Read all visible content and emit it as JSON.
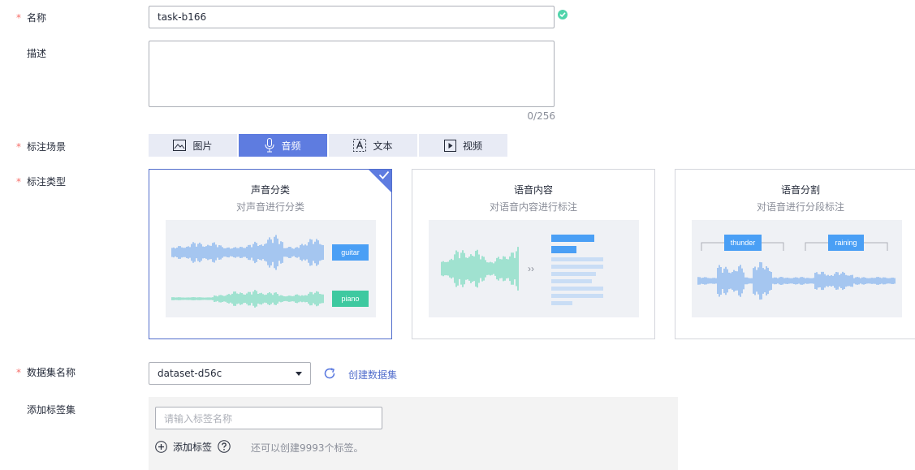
{
  "form": {
    "name": {
      "label": "名称",
      "value": "task-b166"
    },
    "description": {
      "label": "描述",
      "counter": "0/256"
    },
    "scene": {
      "label": "标注场景",
      "tabs": [
        {
          "label": "图片",
          "icon": "image-icon"
        },
        {
          "label": "音频",
          "icon": "microphone-icon",
          "active": true
        },
        {
          "label": "文本",
          "icon": "text-icon"
        },
        {
          "label": "视频",
          "icon": "video-icon"
        }
      ]
    },
    "type": {
      "label": "标注类型",
      "cards": [
        {
          "title": "声音分类",
          "subtitle": "对声音进行分类",
          "tags": [
            "guitar",
            "piano"
          ],
          "selected": true
        },
        {
          "title": "语音内容",
          "subtitle": "对语音内容进行标注"
        },
        {
          "title": "语音分割",
          "subtitle": "对语音进行分段标注",
          "tags": [
            "thunder",
            "raining"
          ]
        }
      ]
    },
    "dataset": {
      "label": "数据集名称",
      "value": "dataset-d56c",
      "create_link": "创建数据集"
    },
    "tagset": {
      "label": "添加标签集",
      "placeholder": "请输入标签名称",
      "add_label": "添加标签",
      "remaining": "还可以创建9993个标签。"
    }
  },
  "colors": {
    "accent": "#5e7ce0",
    "required": "#f66f6a",
    "success": "#50d4ab",
    "wave_blue": "#5b9bec",
    "wave_green": "#50d4ab"
  }
}
